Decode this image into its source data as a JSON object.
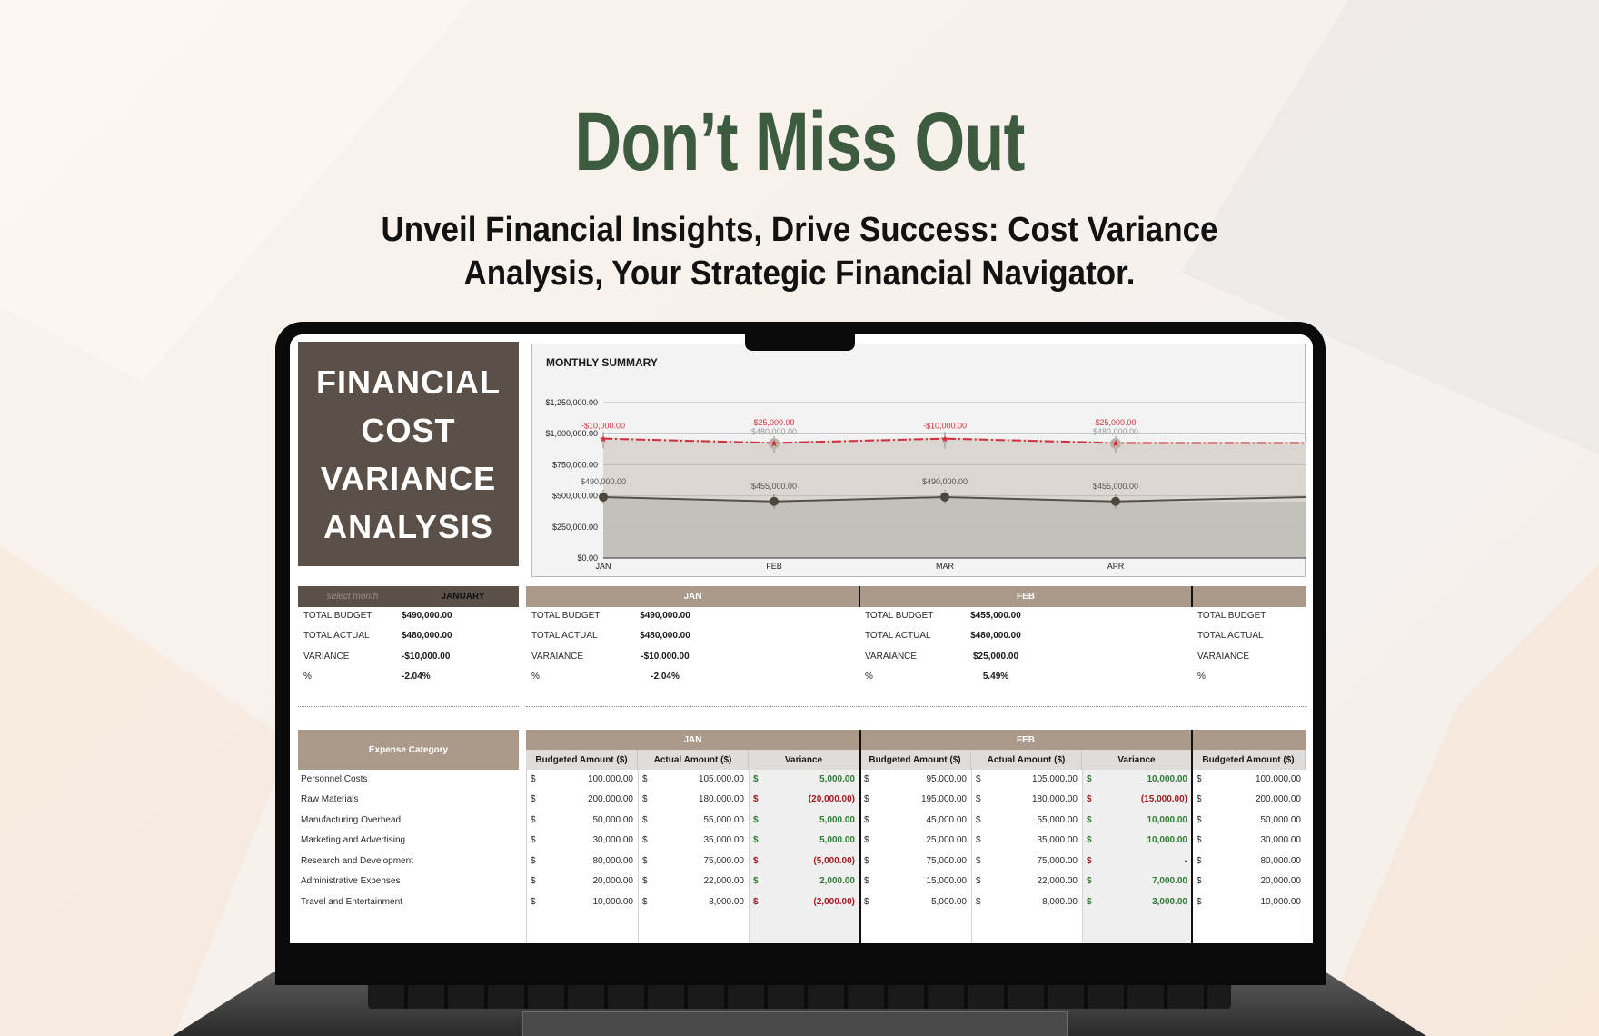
{
  "page": {
    "headline": "Don’t Miss Out",
    "subline_1": "Unveil Financial Insights, Drive Success: Cost Variance",
    "subline_2": "Analysis, Your Strategic Financial Navigator."
  },
  "colors": {
    "headline_green": "#3d5b3e",
    "title_box_brown": "#5a5048",
    "header_taupe": "#ab998a",
    "positive_green": "#2e7d32",
    "negative_red": "#a01c22",
    "variance_line_red": "#d0313b"
  },
  "dashboard": {
    "title_lines": [
      "FINANCIAL",
      "COST",
      "VARIANCE",
      "ANALYSIS"
    ],
    "selector": {
      "label": "select month",
      "value": "JANUARY"
    },
    "selected_summary": {
      "rows": [
        {
          "label": "TOTAL BUDGET",
          "value": "$490,000.00"
        },
        {
          "label": "TOTAL ACTUAL",
          "value": "$480,000.00"
        },
        {
          "label": "VARIANCE",
          "value": "-$10,000.00"
        },
        {
          "label": "%",
          "value": "-2.04%"
        }
      ]
    },
    "month_summaries": [
      {
        "month": "JAN",
        "rows": [
          {
            "label": "TOTAL BUDGET",
            "value": "$490,000.00"
          },
          {
            "label": "TOTAL ACTUAL",
            "value": "$480,000.00"
          },
          {
            "label": "VARAIANCE",
            "value": "-$10,000.00"
          },
          {
            "label": "%",
            "value": "-2.04%"
          }
        ]
      },
      {
        "month": "FEB",
        "rows": [
          {
            "label": "TOTAL BUDGET",
            "value": "$455,000.00"
          },
          {
            "label": "TOTAL ACTUAL",
            "value": "$480,000.00"
          },
          {
            "label": "VARAIANCE",
            "value": "$25,000.00"
          },
          {
            "label": "%",
            "value": "5.49%"
          }
        ]
      },
      {
        "month": "",
        "rows": [
          {
            "label": "TOTAL BUDGET",
            "value": ""
          },
          {
            "label": "TOTAL ACTUAL",
            "value": ""
          },
          {
            "label": "VARAIANCE",
            "value": ""
          },
          {
            "label": "%",
            "value": ""
          }
        ]
      }
    ],
    "expense_table": {
      "category_header": "Expense Category",
      "column_headers": {
        "budget": "Budgeted Amount ($)",
        "actual": "Actual Amount ($)",
        "variance": "Variance"
      },
      "currency_symbol": "$",
      "categories": [
        "Personnel Costs",
        "Raw Materials",
        "Manufacturing Overhead",
        "Marketing and Advertising",
        "Research and Development",
        "Administrative Expenses",
        "Travel and Entertainment"
      ],
      "months": [
        {
          "month": "JAN",
          "budget": [
            "100,000.00",
            "200,000.00",
            "50,000.00",
            "30,000.00",
            "80,000.00",
            "20,000.00",
            "10,000.00"
          ],
          "actual": [
            "105,000.00",
            "180,000.00",
            "55,000.00",
            "35,000.00",
            "75,000.00",
            "22,000.00",
            "8,000.00"
          ],
          "variance": [
            "5,000.00",
            "(20,000.00)",
            "5,000.00",
            "5,000.00",
            "(5,000.00)",
            "2,000.00",
            "(2,000.00)"
          ],
          "variance_sign": [
            "pos",
            "neg",
            "pos",
            "pos",
            "neg",
            "pos",
            "neg"
          ]
        },
        {
          "month": "FEB",
          "budget": [
            "95,000.00",
            "195,000.00",
            "45,000.00",
            "25,000.00",
            "75,000.00",
            "15,000.00",
            "5,000.00"
          ],
          "actual": [
            "105,000.00",
            "180,000.00",
            "55,000.00",
            "35,000.00",
            "75,000.00",
            "22,000.00",
            "8,000.00"
          ],
          "variance": [
            "10,000.00",
            "(15,000.00)",
            "10,000.00",
            "10,000.00",
            "-",
            "7,000.00",
            "3,000.00"
          ],
          "variance_sign": [
            "pos",
            "neg",
            "pos",
            "pos",
            "neg",
            "pos",
            "pos"
          ]
        },
        {
          "month": "",
          "budget": [
            "100,000.00",
            "200,000.00",
            "50,000.00",
            "30,000.00",
            "80,000.00",
            "20,000.00",
            "10,000.00"
          ]
        }
      ]
    }
  },
  "chart_data": {
    "type": "area",
    "title": "MONTHLY SUMMARY",
    "categories": [
      "JAN",
      "FEB",
      "MAR",
      "APR"
    ],
    "stacked": true,
    "series": [
      {
        "name": "Total Budget",
        "values": [
          490000,
          455000,
          490000,
          455000
        ],
        "labels": [
          "$490,000.00",
          "$455,000.00",
          "$490,000.00",
          "$455,000.00"
        ],
        "color": "#c4c0bc",
        "line_color": "#555048"
      },
      {
        "name": "Total Actual",
        "values": [
          480000,
          480000,
          480000,
          480000
        ],
        "labels": [
          "",
          "$480,000.00",
          "",
          "$480,000.00"
        ],
        "color": "#dbd6d1"
      },
      {
        "name": "Variance",
        "values": [
          -10000,
          25000,
          -10000,
          25000
        ],
        "labels": [
          "-$10,000.00",
          "$25,000.00",
          "-$10,000.00",
          "$25,000.00"
        ],
        "color": "#d0313b",
        "style": "dash-dot"
      }
    ],
    "yticks": [
      "$0.00",
      "$250,000.00",
      "$500,000.00",
      "$750,000.00",
      "$1,000,000.00",
      "$1,250,000.00"
    ],
    "ylim": [
      0,
      1250000
    ],
    "xlabel": "",
    "ylabel": "",
    "grid": true,
    "legend": "none"
  }
}
